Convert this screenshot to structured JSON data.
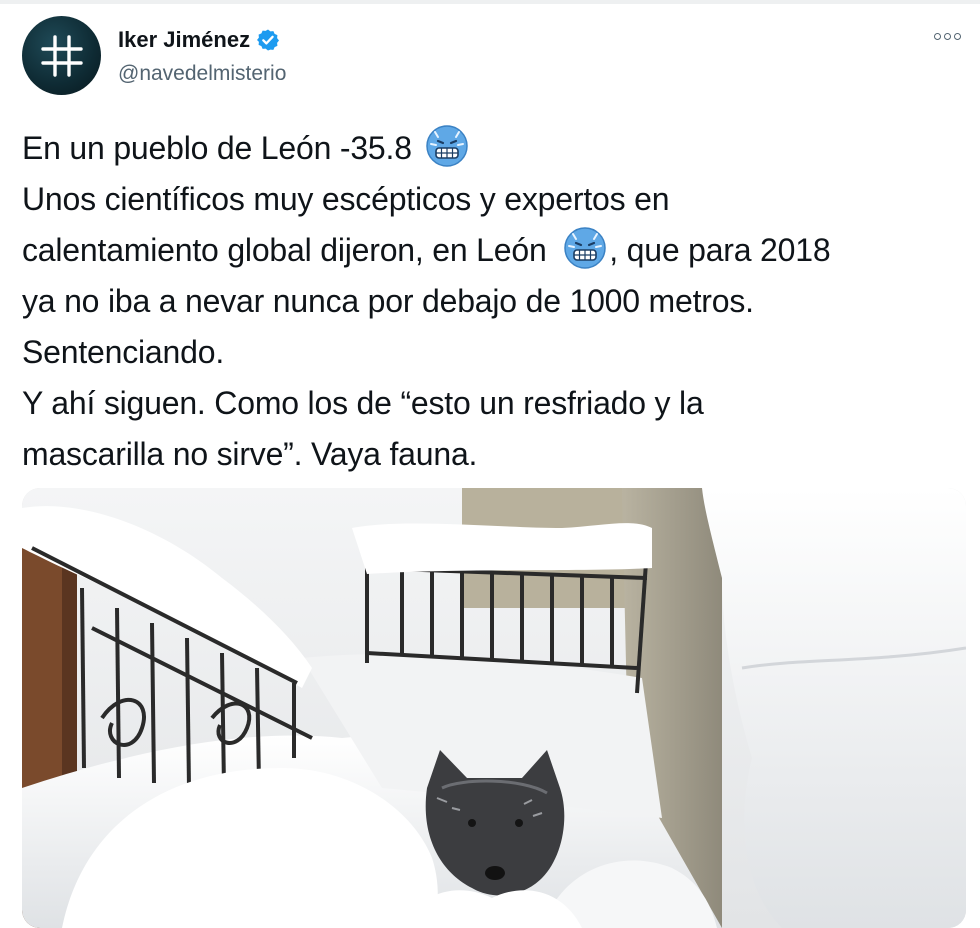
{
  "author": {
    "name": "Iker Jiménez",
    "handle": "@navedelmisterio",
    "verified": true,
    "avatar_icon": "hashtag-icon"
  },
  "tweet": {
    "line1": "En un pueblo de León -35.8",
    "line2": "Unos científicos muy escépticos y expertos en",
    "line3a": "calentamiento global dijeron, en León",
    "line3b": ", que para 2018",
    "line4": "ya no iba a nevar nunca por debajo de 1000 metros.",
    "line5": "Sentenciando.",
    "line6": "Y ahí siguen. Como los de “esto un resfriado y la",
    "line7": "mascarilla no sirve”. Vaya fauna.",
    "emoji": "cold-face-emoji"
  },
  "media": {
    "kind": "photo",
    "subject": "snowy staircase with animal"
  },
  "colors": {
    "text": "#0f1419",
    "secondary": "#536471",
    "verified_blue": "#1d9bf0",
    "emoji_blue": "#5fa8e6"
  }
}
